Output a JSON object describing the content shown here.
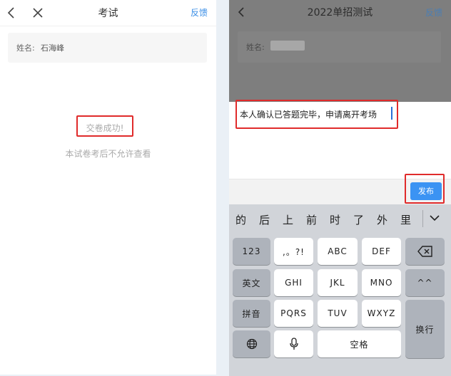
{
  "left": {
    "nav": {
      "title": "考试",
      "feedback": "反馈"
    },
    "name_label": "姓名:",
    "name_value": "石海峰",
    "success_text": "交卷成功!",
    "note_text": "本试卷考后不允许查看"
  },
  "right": {
    "nav": {
      "title": "2022单招测试",
      "feedback": "反馈"
    },
    "name_label": "姓名:",
    "input_text": "本人确认已答题完毕，申请离开考场",
    "publish_label": "发布",
    "candidates": [
      "的",
      "后",
      "上",
      "前",
      "时",
      "了",
      "外",
      "里"
    ],
    "keys": {
      "k123": "123",
      "punct": ",。?!",
      "abc": "ABC",
      "def": "DEF",
      "en": "英文",
      "ghi": "GHI",
      "jkl": "JKL",
      "mno": "MNO",
      "face": "^^",
      "pinyin": "拼音",
      "pqrs": "PQRS",
      "tuv": "TUV",
      "wxyz": "WXYZ",
      "enter": "换行",
      "space": "空格"
    }
  },
  "colors": {
    "accent": "#3b93f3",
    "highlight": "#e02b2b",
    "link": "#3a8ee6"
  }
}
